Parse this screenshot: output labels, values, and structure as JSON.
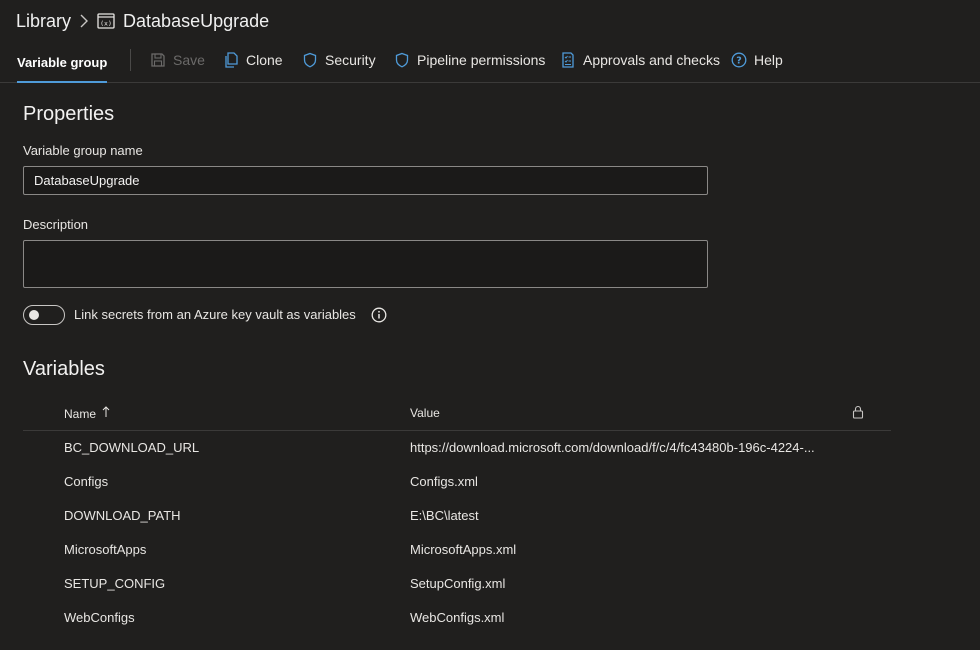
{
  "breadcrumb": {
    "library": "Library",
    "current": "DatabaseUpgrade",
    "current_icon": "variable-group-icon"
  },
  "toolbar": {
    "tab_label": "Variable group",
    "save_label": "Save",
    "clone_label": "Clone",
    "security_label": "Security",
    "pipeline_permissions_label": "Pipeline permissions",
    "approvals_label": "Approvals and checks",
    "help_label": "Help"
  },
  "properties": {
    "heading": "Properties",
    "name_label": "Variable group name",
    "name_value": "DatabaseUpgrade",
    "description_label": "Description",
    "description_value": "",
    "link_secrets_label": "Link secrets from an Azure key vault as variables",
    "link_secrets_enabled": false
  },
  "variables": {
    "heading": "Variables",
    "columns": {
      "name": "Name",
      "value": "Value"
    },
    "rows": [
      {
        "name": "BC_DOWNLOAD_URL",
        "value": "https://download.microsoft.com/download/f/c/4/fc43480b-196c-4224-..."
      },
      {
        "name": "Configs",
        "value": "Configs.xml"
      },
      {
        "name": "DOWNLOAD_PATH",
        "value": "E:\\BC\\latest"
      },
      {
        "name": "MicrosoftApps",
        "value": "MicrosoftApps.xml"
      },
      {
        "name": "SETUP_CONFIG",
        "value": "SetupConfig.xml"
      },
      {
        "name": "WebConfigs",
        "value": "WebConfigs.xml"
      }
    ]
  },
  "colors": {
    "background": "#201f1e",
    "accent": "#4f9bd9",
    "border": "#8a8886"
  }
}
